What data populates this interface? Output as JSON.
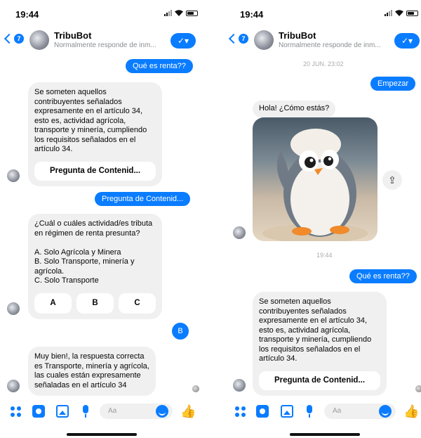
{
  "status": {
    "time": "19:44"
  },
  "header": {
    "title": "TribuBot",
    "subtitle": "Normalmente responde de inm...",
    "check_icon": "✓▾"
  },
  "phone1": {
    "out1": "Qué es renta??",
    "card1_text": "Se someten aquellos\ncontribuyentes señalados\nexpresamente en el artículo 34,\nesto es, actividad agrícola,\ntransporte y minería, cumpliendo\nlos requisitos señalados en el\nartículo 34.",
    "card1_button": "Pregunta de Contenid...",
    "out2": "Pregunta de Contenid...",
    "card2_text": "¿Cuál o cuáles actividad/es tributa\nen régimen de renta presunta?\n\nA. Solo Agrícola y Minera\nB. Solo Transporte, minería y\nagrícola.\nC. Solo Transporte",
    "options": [
      "A",
      "B",
      "C"
    ],
    "out3": "B",
    "card3_text": "Muy bien!,  la respuesta correcta\nes Transporte, minería y agrícola,\nlas cuales están expresamente\nseñaladas en el artículo 34"
  },
  "phone2": {
    "date_stamp": "20 JUN. 23:02",
    "out1": "Empezar",
    "greeting": "Hola! ¿Cómo estás?",
    "time_stamp": "19:44",
    "out2": "Qué es renta??",
    "card1_text": "Se someten aquellos\ncontribuyentes señalados\nexpresamente en el artículo 34,\nesto es, actividad agrícola,\ntransporte y minería, cumpliendo\nlos requisitos señalados en el\nartículo 34.",
    "card1_button": "Pregunta de Contenid..."
  },
  "composer": {
    "placeholder": "Aa"
  },
  "icons": [
    "back-chevron-icon",
    "apps-icon",
    "camera-icon",
    "gallery-icon",
    "mic-icon",
    "emoji-icon",
    "thumbs-up-icon",
    "share-icon"
  ],
  "colors": {
    "accent": "#0a7cff",
    "bubble_gray": "#f0f0f0"
  }
}
